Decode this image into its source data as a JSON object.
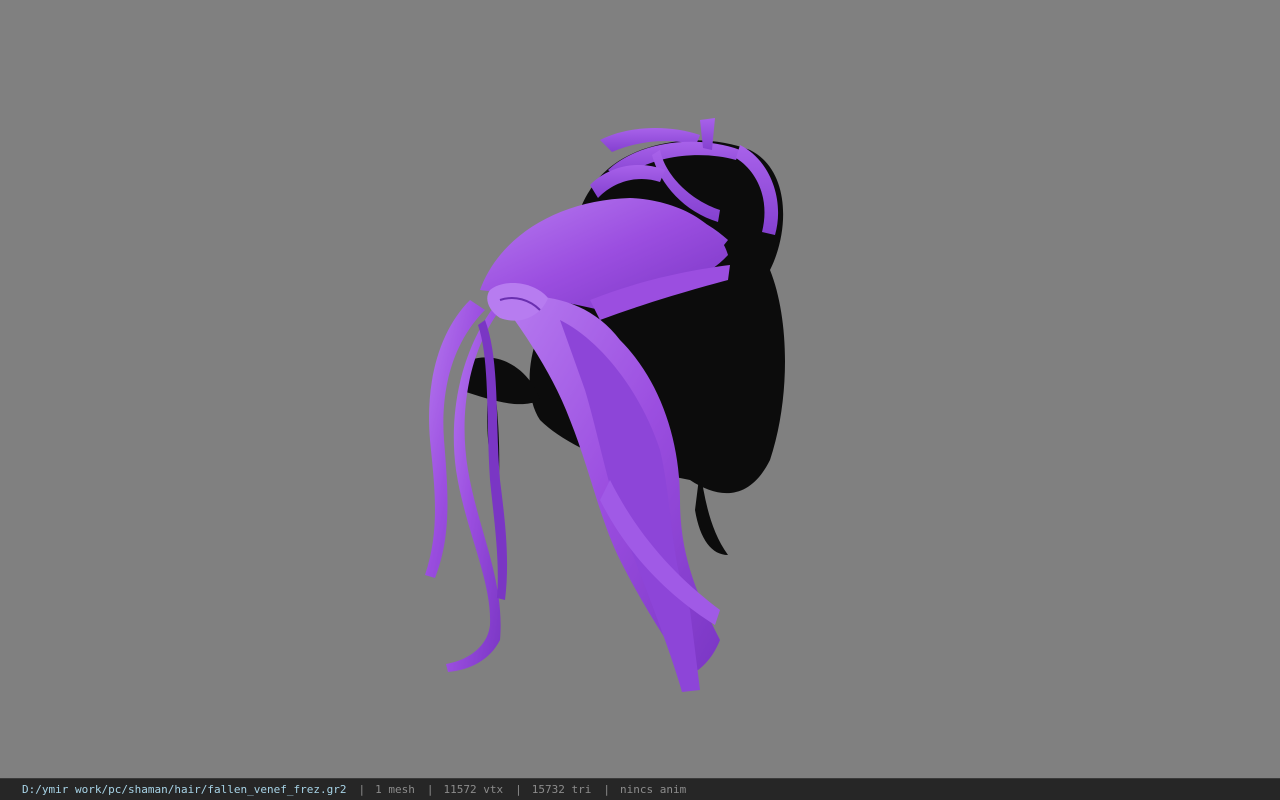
{
  "viewport": {
    "background_color": "#808080",
    "model_colors": {
      "hair_primary": "#9b4ee0",
      "hair_highlight": "#b77cf0",
      "hair_shadow": "#6a2fb0",
      "hair_dark": "#0c0c0c"
    }
  },
  "statusbar": {
    "file_path": "D:/ymir work/pc/shaman/hair/fallen_venef_frez.gr2",
    "separator": "|",
    "mesh_count": "1 mesh",
    "vertex_count": "11572 vtx",
    "triangle_count": "15732 tri",
    "animation": "nincs anim"
  }
}
